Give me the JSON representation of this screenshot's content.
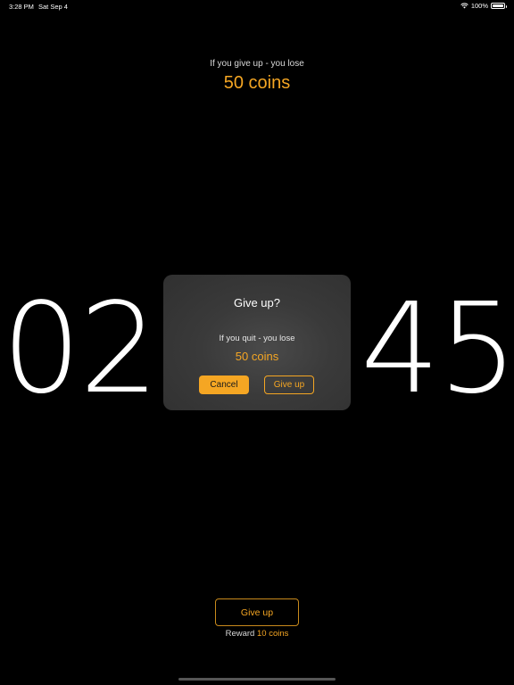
{
  "status_bar": {
    "time": "3:28 PM",
    "date": "Sat Sep 4",
    "battery": "100%",
    "battery_level": 1.0,
    "icons": [
      "wifi-icon",
      "battery-icon"
    ]
  },
  "top_warning": {
    "text": "If you give up - you lose",
    "coins": "50 coins"
  },
  "timer": {
    "minutes": "02",
    "seconds": "45"
  },
  "dialog": {
    "title": "Give up?",
    "message": "If you quit - you lose",
    "coins": "50 coins",
    "cancel_label": "Cancel",
    "giveup_label": "Give up"
  },
  "bottom": {
    "giveup_label": "Give up",
    "reward_prefix": "Reward",
    "reward_coins": "10 coins"
  },
  "colors": {
    "accent": "#f5a623",
    "background": "#000000",
    "dialog_bg": "#3a3a3a"
  }
}
